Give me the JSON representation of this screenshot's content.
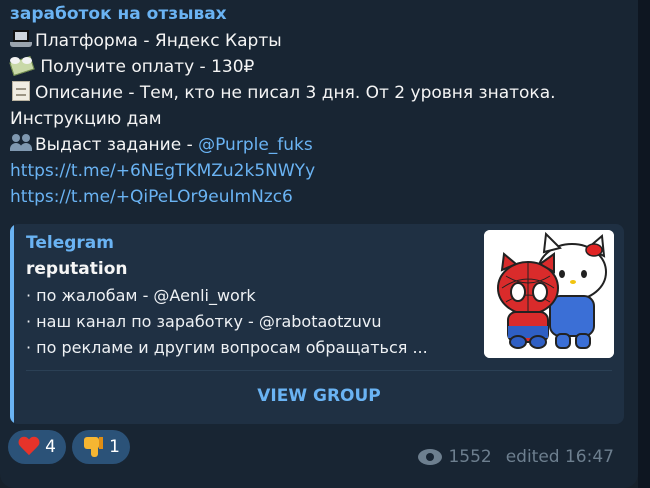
{
  "message": {
    "sender": "заработок на отзывах",
    "lines": [
      {
        "icon": "laptop-icon",
        "text": "Платформа - Яндекс Карты"
      },
      {
        "icon": "money-with-wings-icon",
        "text": " Получите оплату - 130₽"
      },
      {
        "icon": "document-icon",
        "text": "Описание -  Тем, кто не писал 3 дня. От 2 уровня знатока."
      },
      {
        "icon": "",
        "text": "Инструкцию дам"
      },
      {
        "icon": "people-icon",
        "text": "Выдаст задание - ",
        "mention": "@Purple_fuks"
      }
    ],
    "links": [
      "https://t.me/+6NEgTKMZu2k5NWYy",
      "https://t.me/+QiPeLOr9euImNzc6"
    ]
  },
  "preview": {
    "site": "Telegram",
    "title": "reputation",
    "desc": [
      "· по жалобам - @Aenli_work",
      "· наш канал по заработку - @rabotaotzuvu",
      "· по рекламе и другим вопросам обращаться ..."
    ],
    "button": "VIEW GROUP",
    "thumbnail": "spider-kitty-sticker"
  },
  "reactions": [
    {
      "icon": "heart-icon",
      "count": "4"
    },
    {
      "icon": "thumbs-down-icon",
      "count": "1"
    }
  ],
  "meta": {
    "views": "1552",
    "edited": "edited 16:47"
  },
  "colors": {
    "background": "#17212b",
    "bubble": "#182533",
    "link": "#6ab3f3",
    "card": "#1f3043",
    "reaction": "#2b5278"
  }
}
